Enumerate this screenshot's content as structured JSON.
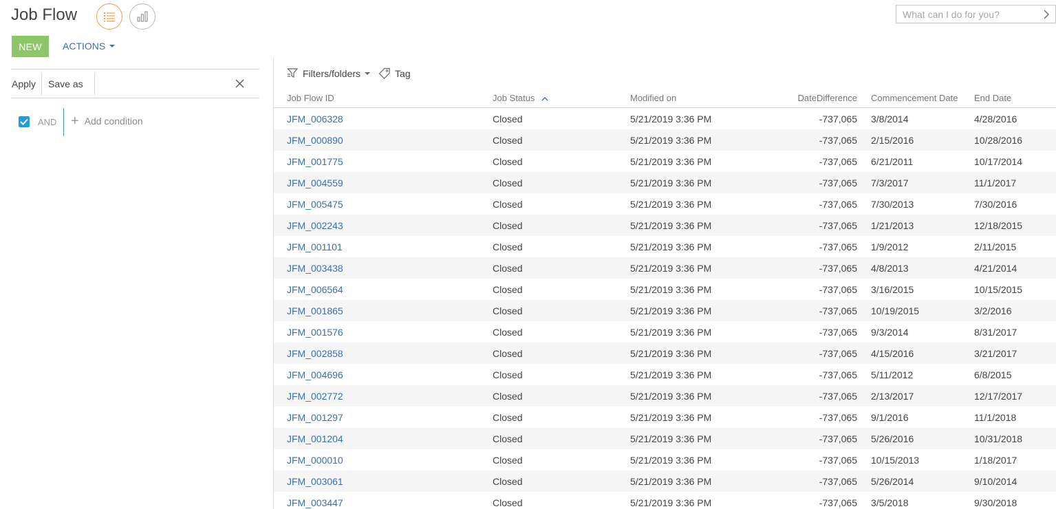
{
  "header": {
    "title": "Job Flow",
    "view_list_icon": "list-view-icon",
    "view_chart_icon": "analytics-view-icon"
  },
  "search": {
    "placeholder": "What can I do for you?"
  },
  "actions": {
    "new_label": "NEW",
    "actions_label": "ACTIONS"
  },
  "filter": {
    "apply_label": "Apply",
    "save_as_label": "Save as",
    "and_label": "AND",
    "add_condition_label": "Add condition"
  },
  "toolbar": {
    "filters_label": "Filters/folders",
    "tag_label": "Tag"
  },
  "colors": {
    "accent_orange": "#f39a4a",
    "new_green": "#8dc56b",
    "link_blue": "#3a6fb3",
    "checkbox_blue": "#1e9ee0"
  },
  "table": {
    "columns": [
      "Job Flow ID",
      "Job Status",
      "Modified on",
      "DateDifference",
      "Commencement Date",
      "End Date"
    ],
    "rows": [
      [
        "JFM_006328",
        "Closed",
        "5/21/2019 3:36 PM",
        "-737,065",
        "3/8/2014",
        "4/28/2016"
      ],
      [
        "JFM_000890",
        "Closed",
        "5/21/2019 3:36 PM",
        "-737,065",
        "2/15/2016",
        "10/28/2016"
      ],
      [
        "JFM_001775",
        "Closed",
        "5/21/2019 3:36 PM",
        "-737,065",
        "6/21/2011",
        "10/17/2014"
      ],
      [
        "JFM_004559",
        "Closed",
        "5/21/2019 3:36 PM",
        "-737,065",
        "7/3/2017",
        "11/1/2017"
      ],
      [
        "JFM_005475",
        "Closed",
        "5/21/2019 3:36 PM",
        "-737,065",
        "7/30/2013",
        "7/30/2016"
      ],
      [
        "JFM_002243",
        "Closed",
        "5/21/2019 3:36 PM",
        "-737,065",
        "1/21/2013",
        "12/18/2015"
      ],
      [
        "JFM_001101",
        "Closed",
        "5/21/2019 3:36 PM",
        "-737,065",
        "1/9/2012",
        "2/11/2015"
      ],
      [
        "JFM_003438",
        "Closed",
        "5/21/2019 3:36 PM",
        "-737,065",
        "4/8/2013",
        "4/21/2014"
      ],
      [
        "JFM_006564",
        "Closed",
        "5/21/2019 3:36 PM",
        "-737,065",
        "3/16/2015",
        "10/15/2015"
      ],
      [
        "JFM_001865",
        "Closed",
        "5/21/2019 3:36 PM",
        "-737,065",
        "10/19/2015",
        "3/2/2016"
      ],
      [
        "JFM_001576",
        "Closed",
        "5/21/2019 3:36 PM",
        "-737,065",
        "9/3/2014",
        "8/31/2017"
      ],
      [
        "JFM_002858",
        "Closed",
        "5/21/2019 3:36 PM",
        "-737,065",
        "4/15/2016",
        "3/21/2017"
      ],
      [
        "JFM_004696",
        "Closed",
        "5/21/2019 3:36 PM",
        "-737,065",
        "5/11/2012",
        "6/8/2015"
      ],
      [
        "JFM_002772",
        "Closed",
        "5/21/2019 3:36 PM",
        "-737,065",
        "2/13/2017",
        "12/17/2017"
      ],
      [
        "JFM_001297",
        "Closed",
        "5/21/2019 3:36 PM",
        "-737,065",
        "9/1/2016",
        "11/1/2018"
      ],
      [
        "JFM_001204",
        "Closed",
        "5/21/2019 3:36 PM",
        "-737,065",
        "5/26/2016",
        "10/31/2018"
      ],
      [
        "JFM_000010",
        "Closed",
        "5/21/2019 3:36 PM",
        "-737,065",
        "10/15/2013",
        "1/18/2017"
      ],
      [
        "JFM_003061",
        "Closed",
        "5/21/2019 3:36 PM",
        "-737,065",
        "5/26/2014",
        "9/10/2014"
      ],
      [
        "JFM_003447",
        "Closed",
        "5/21/2019 3:36 PM",
        "-737,065",
        "3/5/2018",
        "9/30/2018"
      ]
    ]
  }
}
